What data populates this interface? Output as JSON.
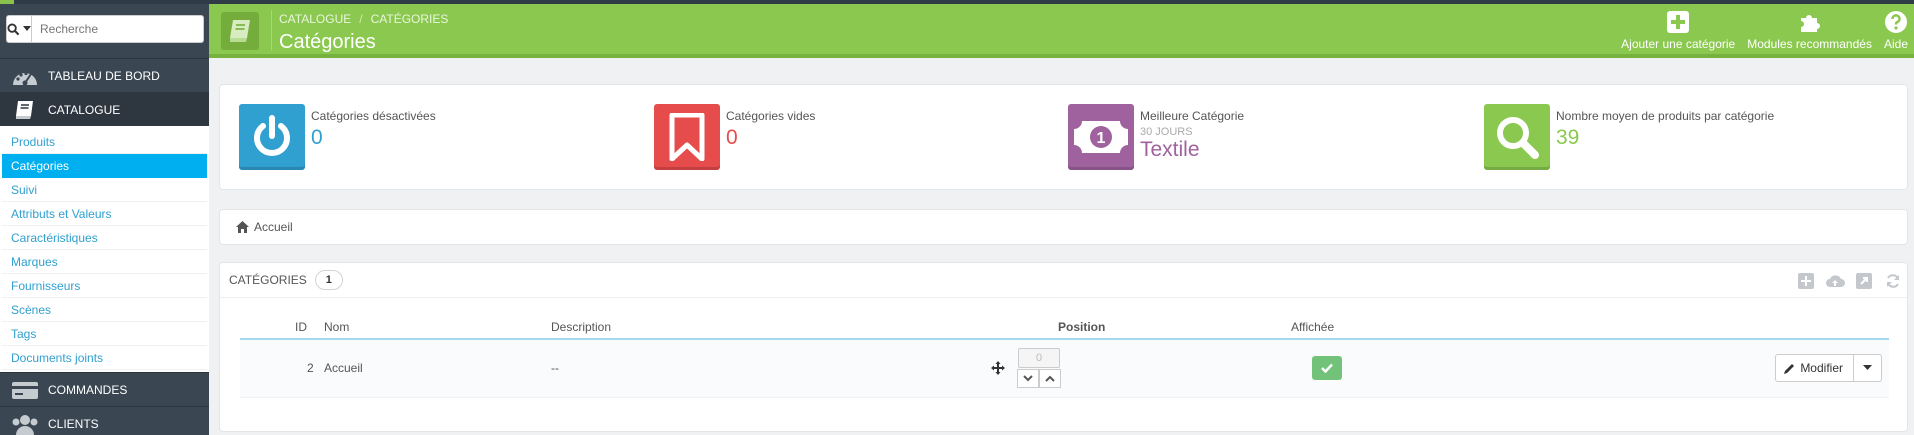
{
  "colors": {
    "header_green": "#8bc84f",
    "sidebar_dark": "#3a4752",
    "active_blue": "#00aff0",
    "link_blue": "#2fa0d0",
    "kpi_blue": "#2fa0d0",
    "kpi_red": "#e74c4c",
    "kpi_purple": "#a0629e",
    "kpi_green": "#8bc84f"
  },
  "sidebar": {
    "search": {
      "placeholder": "Recherche",
      "icon": "search-icon"
    },
    "dashboard": {
      "label": "TABLEAU DE BORD",
      "icon": "dashboard-icon"
    },
    "catalogue": {
      "label": "CATALOGUE",
      "icon": "book-icon",
      "items": [
        {
          "label": "Produits"
        },
        {
          "label": "Catégories",
          "active": true
        },
        {
          "label": "Suivi"
        },
        {
          "label": "Attributs et Valeurs"
        },
        {
          "label": "Caractéristiques"
        },
        {
          "label": "Marques"
        },
        {
          "label": "Fournisseurs"
        },
        {
          "label": "Scènes"
        },
        {
          "label": "Tags"
        },
        {
          "label": "Documents joints"
        }
      ]
    },
    "orders": {
      "label": "COMMANDES",
      "icon": "credit-card-icon"
    },
    "customers": {
      "label": "CLIENTS",
      "icon": "users-icon"
    }
  },
  "header": {
    "breadcrumb_1": "CATALOGUE",
    "breadcrumb_sep": "/",
    "breadcrumb_2": "CATÉGORIES",
    "title": "Catégories",
    "toolbar": {
      "add": "Ajouter une catégorie",
      "modules": "Modules recommandés",
      "help": "Aide"
    }
  },
  "kpis": [
    {
      "label": "Catégories désactivées",
      "value": "0",
      "icon": "power-icon",
      "color": "#2fa0d0"
    },
    {
      "label": "Catégories vides",
      "value": "0",
      "icon": "bookmark-icon",
      "color": "#e74c4c"
    },
    {
      "label": "Meilleure Catégorie",
      "sub": "30 JOURS",
      "value": "Textile",
      "icon": "banknote-icon",
      "color": "#a0629e"
    },
    {
      "label": "Nombre moyen de produits par catégorie",
      "value": "39",
      "icon": "search-icon",
      "color": "#8bc84f"
    }
  ],
  "crumbs": {
    "home": "Accueil"
  },
  "categories": {
    "title": "CATÉGORIES",
    "count": "1",
    "columns": {
      "id": "ID",
      "name": "Nom",
      "description": "Description",
      "position": "Position",
      "displayed": "Affichée"
    },
    "rows": [
      {
        "id": "2",
        "name": "Accueil",
        "description": "--",
        "position": "0",
        "displayed": true,
        "action": "Modifier"
      }
    ]
  }
}
